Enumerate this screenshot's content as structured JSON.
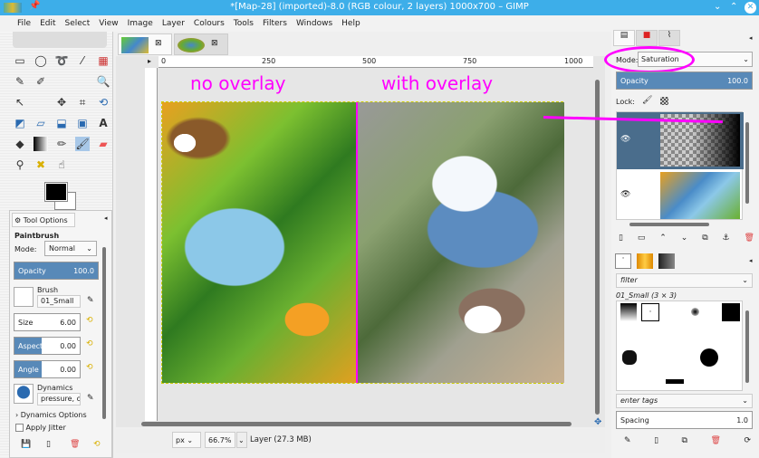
{
  "window": {
    "title": "*[Map-28] (imported)-8.0 (RGB colour, 2 layers) 1000x700 – GIMP",
    "controls": [
      "minimize",
      "maximize",
      "close"
    ]
  },
  "menu": [
    "File",
    "Edit",
    "Select",
    "View",
    "Image",
    "Layer",
    "Colours",
    "Tools",
    "Filters",
    "Windows",
    "Help"
  ],
  "tool_options": {
    "tab": "Tool Options",
    "tool": "Paintbrush",
    "mode_label": "Mode:",
    "mode": "Normal",
    "opacity_label": "Opacity",
    "opacity": "100.0",
    "opacity_pct": 100,
    "brush_label": "Brush",
    "brush": "01_Small",
    "size_label": "Size",
    "size": "6.00",
    "aspect_label": "Aspect R...",
    "aspect": "0.00",
    "angle_label": "Angle",
    "angle": "0.00",
    "dynamics_label": "Dynamics",
    "dynamics": "pressure, op",
    "dynamics_options": "Dynamics Options",
    "apply_jitter": "Apply Jitter"
  },
  "ruler": {
    "ticks": [
      "0",
      "250",
      "500",
      "750",
      "1000"
    ]
  },
  "annotations": {
    "left": "no overlay",
    "right": "with overlay",
    "color": "#ff00ff"
  },
  "status": {
    "unit": "px",
    "zoom": "66.7%",
    "info": "Layer (27.3 MB)"
  },
  "layers": {
    "mode_label": "Mode:",
    "mode": "Saturation",
    "opacity_label": "Opacity",
    "opacity": "100.0",
    "lock_label": "Lock:"
  },
  "brushes": {
    "filter_placeholder": "filter",
    "selected": "01_Small (3 × 3)",
    "tags_placeholder": "enter tags",
    "spacing_label": "Spacing",
    "spacing": "1.0"
  },
  "colors": {
    "titlebar": "#3daee9",
    "selection": "#5889b8",
    "layer_selected": "#4a6d8c"
  }
}
